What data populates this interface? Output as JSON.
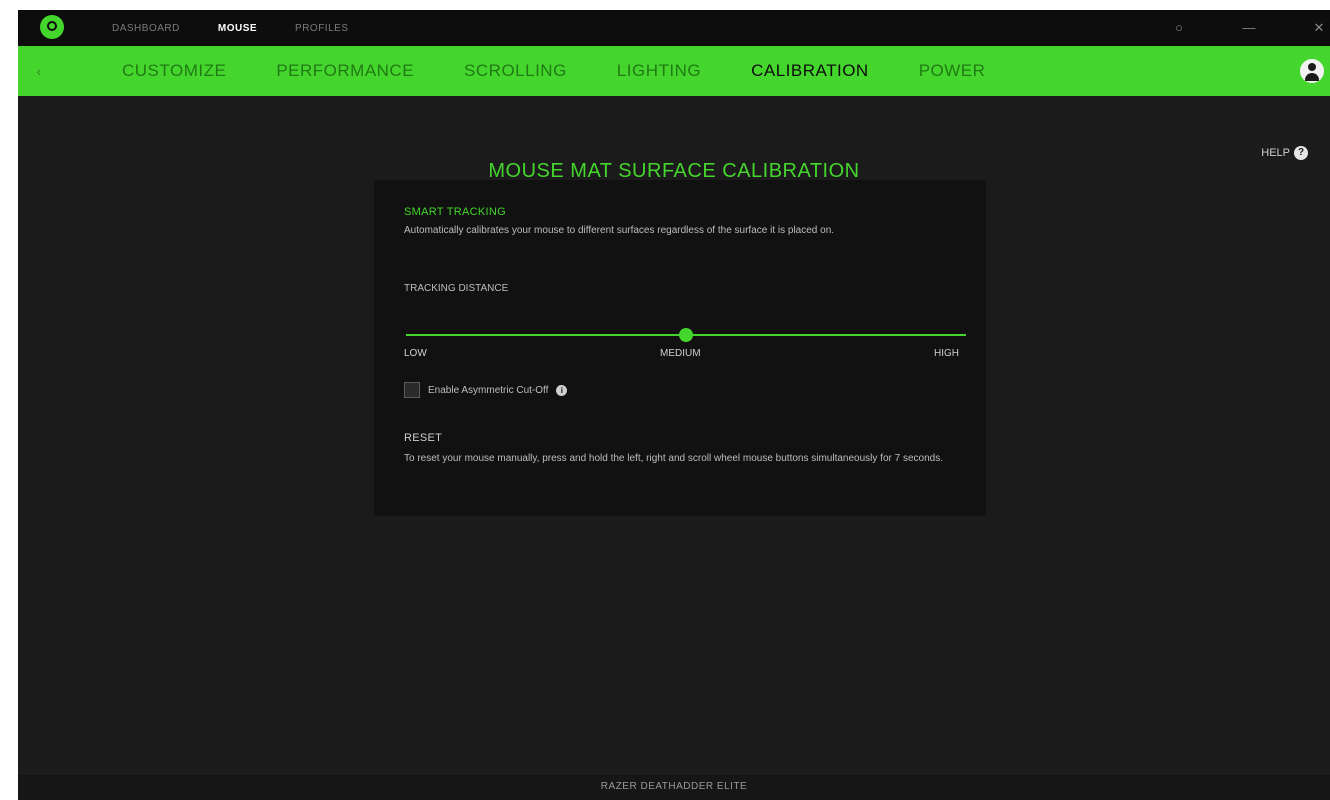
{
  "titlebar": {
    "tabs": [
      {
        "label": "DASHBOARD",
        "active": false
      },
      {
        "label": "MOUSE",
        "active": true
      },
      {
        "label": "PROFILES",
        "active": false
      }
    ],
    "minimize_glyph": "—",
    "close_glyph": "✕",
    "search_glyph": "○"
  },
  "subnav": {
    "back_glyph": "‹",
    "tabs": [
      {
        "label": "CUSTOMIZE",
        "active": false
      },
      {
        "label": "PERFORMANCE",
        "active": false
      },
      {
        "label": "SCROLLING",
        "active": false
      },
      {
        "label": "LIGHTING",
        "active": false
      },
      {
        "label": "CALIBRATION",
        "active": true
      },
      {
        "label": "POWER",
        "active": false
      }
    ]
  },
  "main": {
    "title": "MOUSE MAT SURFACE CALIBRATION",
    "help_label": "HELP",
    "help_glyph": "?"
  },
  "panel": {
    "smart_tracking": {
      "title": "SMART TRACKING",
      "description": "Automatically calibrates your mouse to different surfaces regardless of the surface it is placed on."
    },
    "tracking_distance": {
      "label": "TRACKING DISTANCE",
      "value_fraction": 0.5,
      "stops": [
        "LOW",
        "MEDIUM",
        "HIGH"
      ]
    },
    "asymmetric_cutoff": {
      "label": "Enable Asymmetric Cut-Off",
      "checked": false,
      "info_glyph": "i"
    },
    "reset": {
      "title": "RESET",
      "description": "To reset your mouse manually, press and hold the left, right and scroll wheel mouse buttons simultaneously for 7 seconds."
    }
  },
  "footer": {
    "text": "RAZER DEATHADDER ELITE"
  },
  "colors": {
    "accent": "#44d62c",
    "background": "#1b1b1b",
    "panel": "#111111"
  }
}
